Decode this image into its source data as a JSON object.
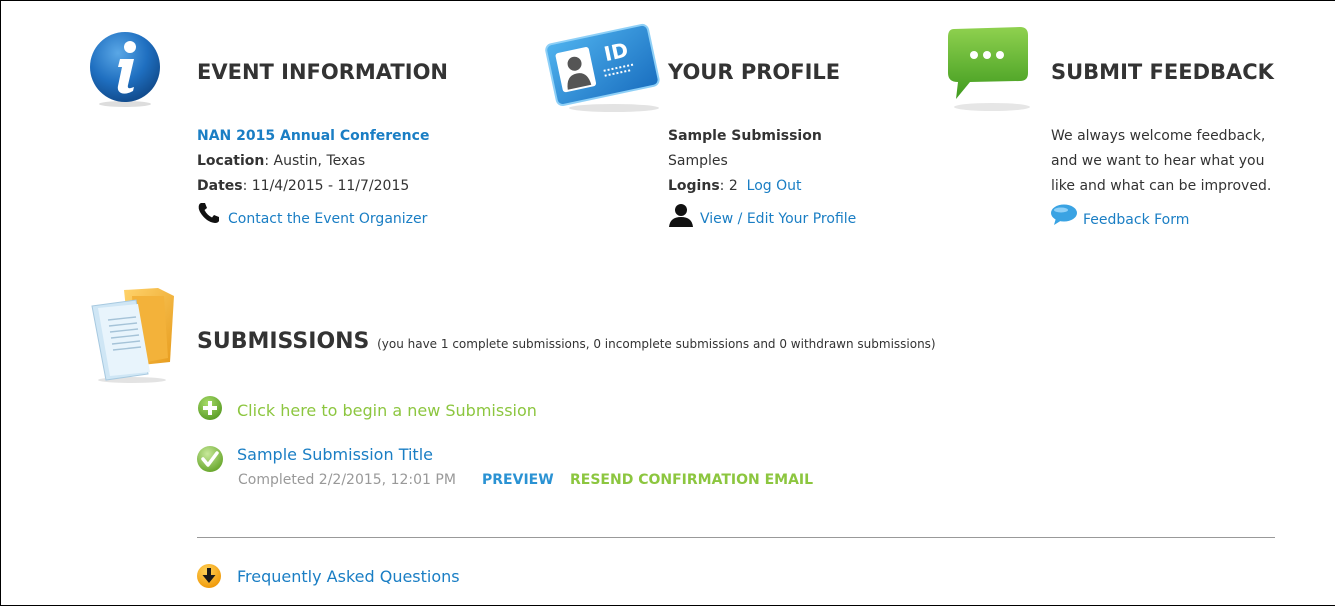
{
  "event": {
    "title": "EVENT INFORMATION",
    "name": "NAN 2015 Annual Conference",
    "location_label": "Location",
    "location_value": ": Austin, Texas",
    "dates_label": "Dates",
    "dates_value": ": 11/4/2015 - 11/7/2015",
    "contact_link": "Contact the Event Organizer",
    "icon": "info-icon"
  },
  "profile": {
    "title": "YOUR PROFILE",
    "submitter": "Sample Submission",
    "org": "Samples",
    "logins_label": "Logins",
    "logins_value": ": 2",
    "logout_link": "Log Out",
    "edit_link": "View / Edit Your Profile",
    "icon": "id-card-icon"
  },
  "feedback": {
    "title": "SUBMIT FEEDBACK",
    "line1": "We always welcome feedback,",
    "line2": "and we want to hear what you",
    "line3": "like and what can be improved.",
    "form_link": "Feedback Form",
    "icon": "chat-bubble-icon"
  },
  "submissions": {
    "title": "SUBMISSIONS",
    "summary": "(you have 1 complete submissions, 0 incomplete submissions and 0 withdrawn submissions)",
    "new_link": "Click here to begin a new Submission",
    "items": [
      {
        "title": "Sample Submission Title",
        "status": "Completed 2/2/2015, 12:01 PM",
        "preview_label": "PREVIEW",
        "resend_label": "RESEND CONFIRMATION EMAIL"
      }
    ]
  },
  "faq": {
    "link": "Frequently Asked Questions"
  },
  "colors": {
    "link_blue": "#1a7ec4",
    "accent_green": "#8cc63f",
    "text": "#333333",
    "muted": "#999999"
  }
}
